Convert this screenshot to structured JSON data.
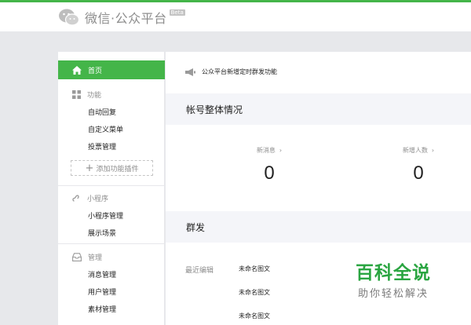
{
  "header": {
    "logo_text": "微信·公众平台",
    "beta_badge": "Beta"
  },
  "sidebar": {
    "home_label": "首页",
    "groups": [
      {
        "title": "功能",
        "icon": "grid-icon",
        "items": [
          "自动回复",
          "自定义菜单",
          "投票管理"
        ]
      },
      {
        "title": "小程序",
        "icon": "mini-program-icon",
        "items": [
          "小程序管理",
          "展示场景"
        ]
      },
      {
        "title": "管理",
        "icon": "inbox-icon",
        "items": [
          "消息管理",
          "用户管理",
          "素材管理"
        ]
      }
    ],
    "add_plugin_label": "添加功能插件"
  },
  "main": {
    "notice_text": "公众平台新增定时群发功能",
    "overview_title": "帐号整体情况",
    "stats": [
      {
        "label": "新消息",
        "value": "0"
      },
      {
        "label": "新增人数",
        "value": "0"
      }
    ],
    "broadcast_title": "群发",
    "recent_label": "最近编辑",
    "drafts": [
      "未命名图文",
      "未命名图文",
      "未命名图文"
    ]
  },
  "watermark": {
    "title": "百科全说",
    "subtitle": "助你轻松解决"
  },
  "colors": {
    "accent": "#44b549",
    "section_bg": "#f4f5f9",
    "page_bg": "#e7e8eb"
  }
}
